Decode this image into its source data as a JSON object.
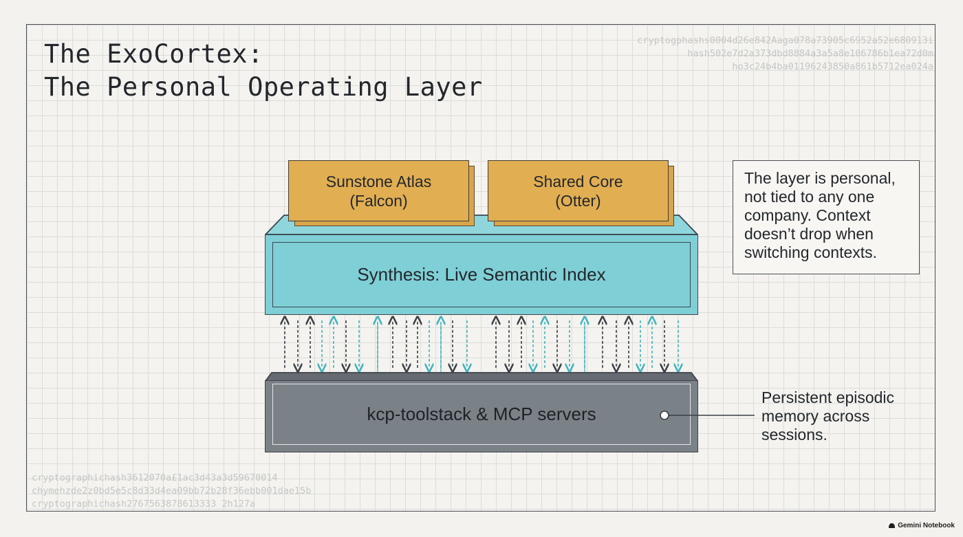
{
  "title": {
    "line1": "The ExoCortex:",
    "line2": "The Personal Operating Layer"
  },
  "hash_top_right": [
    "cryptogphashs0004d26e842Aaga078a73905c6952a52e680913i",
    "hash502e7d2a373dbd8884a3a5a8e106786b1ea72d0m",
    "ho3c24b4ba01196243850a861b5712ea024a"
  ],
  "hash_bottom_left": [
    "cryptographichash3612070a£1ac3d43a3d59670014",
    "chymehzde2z0bd5e5c8d33d4ea09bb72b28f36ebb001dae15b",
    "cryptographichash2767563878613333 2h127a"
  ],
  "diagram": {
    "box_left": {
      "line1": "Sunstone Atlas",
      "line2": "(Falcon)"
    },
    "box_right": {
      "line1": "Shared Core",
      "line2": "(Otter)"
    },
    "synthesis_label": "Synthesis: Live Semantic Index",
    "toolstack_label": "kcp-toolstack & MCP servers"
  },
  "notes": {
    "layer_note": [
      "The layer is personal,",
      "not tied to any one",
      "company. Context",
      "doesn’t drop when",
      "switching contexts."
    ],
    "memory_note": [
      "Persistent episodic",
      "memory across",
      "sessions."
    ]
  },
  "footer": {
    "brand": "Gemini Notebook"
  },
  "colors": {
    "orange": "#e1ae52",
    "teal": "#7fcfd6",
    "gray": "#7a8187",
    "arrow_dark": "#3a3f47",
    "arrow_teal": "#3fb3be"
  }
}
